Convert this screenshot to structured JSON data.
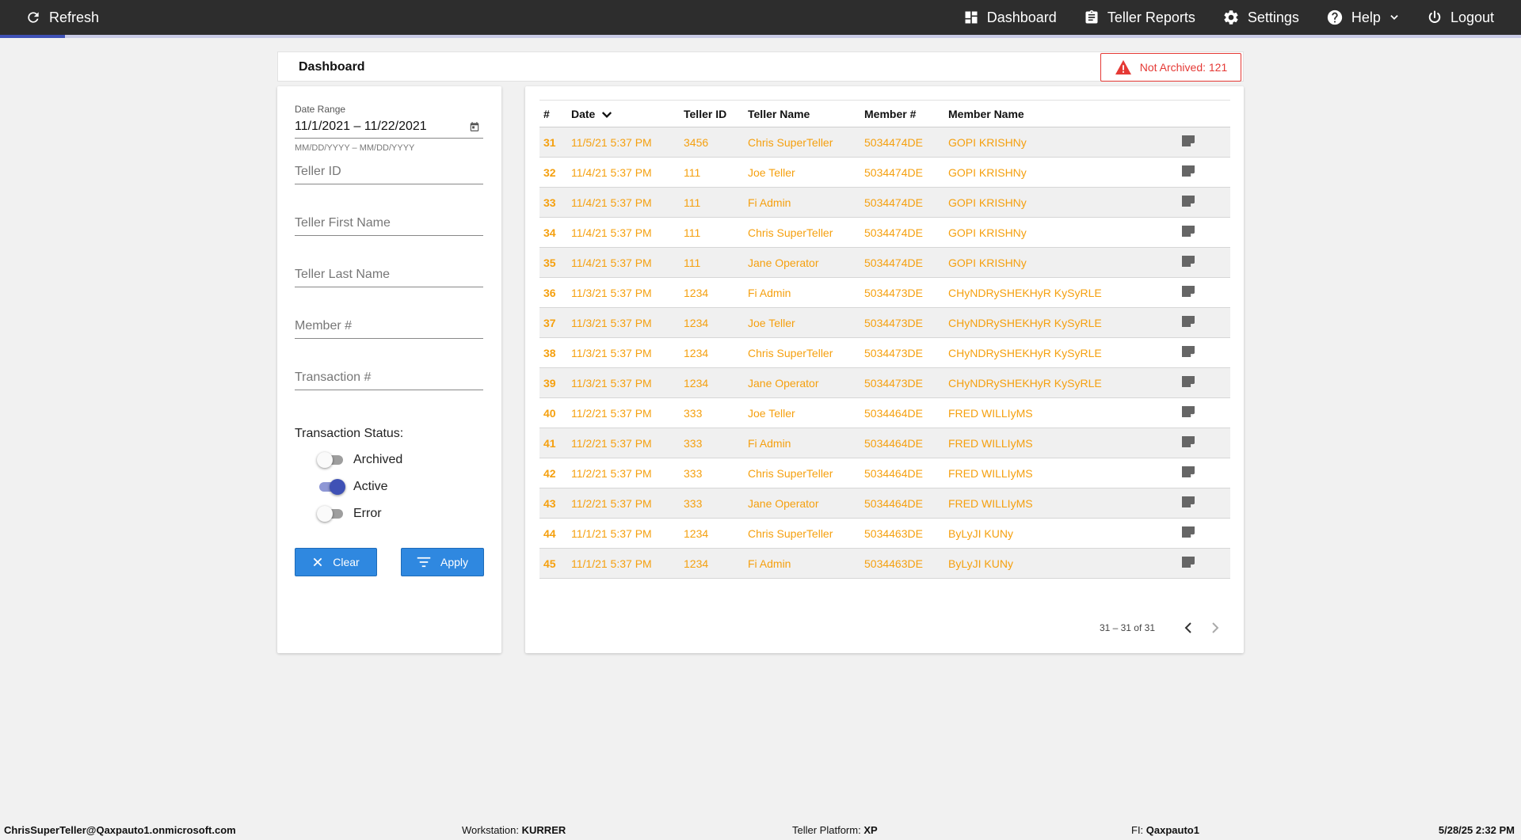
{
  "topbar": {
    "refresh_label": "Refresh",
    "nav": [
      {
        "label": "Dashboard",
        "icon": "dashboard-icon"
      },
      {
        "label": "Teller Reports",
        "icon": "clipboard-icon"
      },
      {
        "label": "Settings",
        "icon": "gear-icon"
      },
      {
        "label": "Help",
        "icon": "help-icon"
      },
      {
        "label": "Logout",
        "icon": "power-icon"
      }
    ]
  },
  "header": {
    "title": "Dashboard",
    "alert": "Not Archived: 121"
  },
  "filters": {
    "date_range_label": "Date Range",
    "date_range_value": "11/1/2021 – 11/22/2021",
    "date_hint": "MM/DD/YYYY – MM/DD/YYYY",
    "teller_id_placeholder": "Teller ID",
    "first_name_placeholder": "Teller First Name",
    "last_name_placeholder": "Teller Last Name",
    "member_placeholder": "Member #",
    "transaction_placeholder": "Transaction #",
    "status_title": "Transaction Status:",
    "statuses": [
      {
        "label": "Archived",
        "on": false
      },
      {
        "label": "Active",
        "on": true
      },
      {
        "label": "Error",
        "on": false
      }
    ],
    "clear_label": "Clear",
    "apply_label": "Apply"
  },
  "table": {
    "headers": [
      "#",
      "Date",
      "Teller ID",
      "Teller Name",
      "Member #",
      "Member Name"
    ],
    "rows": [
      [
        "31",
        "11/5/21 5:37 PM",
        "3456",
        "Chris SuperTeller",
        "5034474DE",
        "GOPI KRISHNy"
      ],
      [
        "32",
        "11/4/21 5:37 PM",
        "111",
        "Joe Teller",
        "5034474DE",
        "GOPI KRISHNy"
      ],
      [
        "33",
        "11/4/21 5:37 PM",
        "111",
        "Fi Admin",
        "5034474DE",
        "GOPI KRISHNy"
      ],
      [
        "34",
        "11/4/21 5:37 PM",
        "111",
        "Chris SuperTeller",
        "5034474DE",
        "GOPI KRISHNy"
      ],
      [
        "35",
        "11/4/21 5:37 PM",
        "111",
        "Jane Operator",
        "5034474DE",
        "GOPI KRISHNy"
      ],
      [
        "36",
        "11/3/21 5:37 PM",
        "1234",
        "Fi Admin",
        "5034473DE",
        "CHyNDRySHEKHyR KySyRLE"
      ],
      [
        "37",
        "11/3/21 5:37 PM",
        "1234",
        "Joe Teller",
        "5034473DE",
        "CHyNDRySHEKHyR KySyRLE"
      ],
      [
        "38",
        "11/3/21 5:37 PM",
        "1234",
        "Chris SuperTeller",
        "5034473DE",
        "CHyNDRySHEKHyR KySyRLE"
      ],
      [
        "39",
        "11/3/21 5:37 PM",
        "1234",
        "Jane Operator",
        "5034473DE",
        "CHyNDRySHEKHyR KySyRLE"
      ],
      [
        "40",
        "11/2/21 5:37 PM",
        "333",
        "Joe Teller",
        "5034464DE",
        "FRED WILLIyMS"
      ],
      [
        "41",
        "11/2/21 5:37 PM",
        "333",
        "Fi Admin",
        "5034464DE",
        "FRED WILLIyMS"
      ],
      [
        "42",
        "11/2/21 5:37 PM",
        "333",
        "Chris SuperTeller",
        "5034464DE",
        "FRED WILLIyMS"
      ],
      [
        "43",
        "11/2/21 5:37 PM",
        "333",
        "Jane Operator",
        "5034464DE",
        "FRED WILLIyMS"
      ],
      [
        "44",
        "11/1/21 5:37 PM",
        "1234",
        "Chris SuperTeller",
        "5034463DE",
        "ByLyJI KUNy"
      ],
      [
        "45",
        "11/1/21 5:37 PM",
        "1234",
        "Fi Admin",
        "5034463DE",
        "ByLyJI KUNy"
      ]
    ],
    "pager_text": "31 – 31 of 31"
  },
  "footer": {
    "user": "ChrisSuperTeller@Qaxpauto1.onmicrosoft.com",
    "workstation_label": "Workstation:",
    "workstation": "KURRER",
    "platform_label": "Teller Platform:",
    "platform": "XP",
    "fi_label": "FI:",
    "fi": "Qaxpauto1",
    "datetime": "5/28/25 2:32 PM"
  },
  "colors": {
    "accent": "#3f51b5",
    "button": "#2f88e0",
    "row_text": "#f5a00f",
    "alert": "#e53935",
    "topbar": "#2d2d2d"
  }
}
